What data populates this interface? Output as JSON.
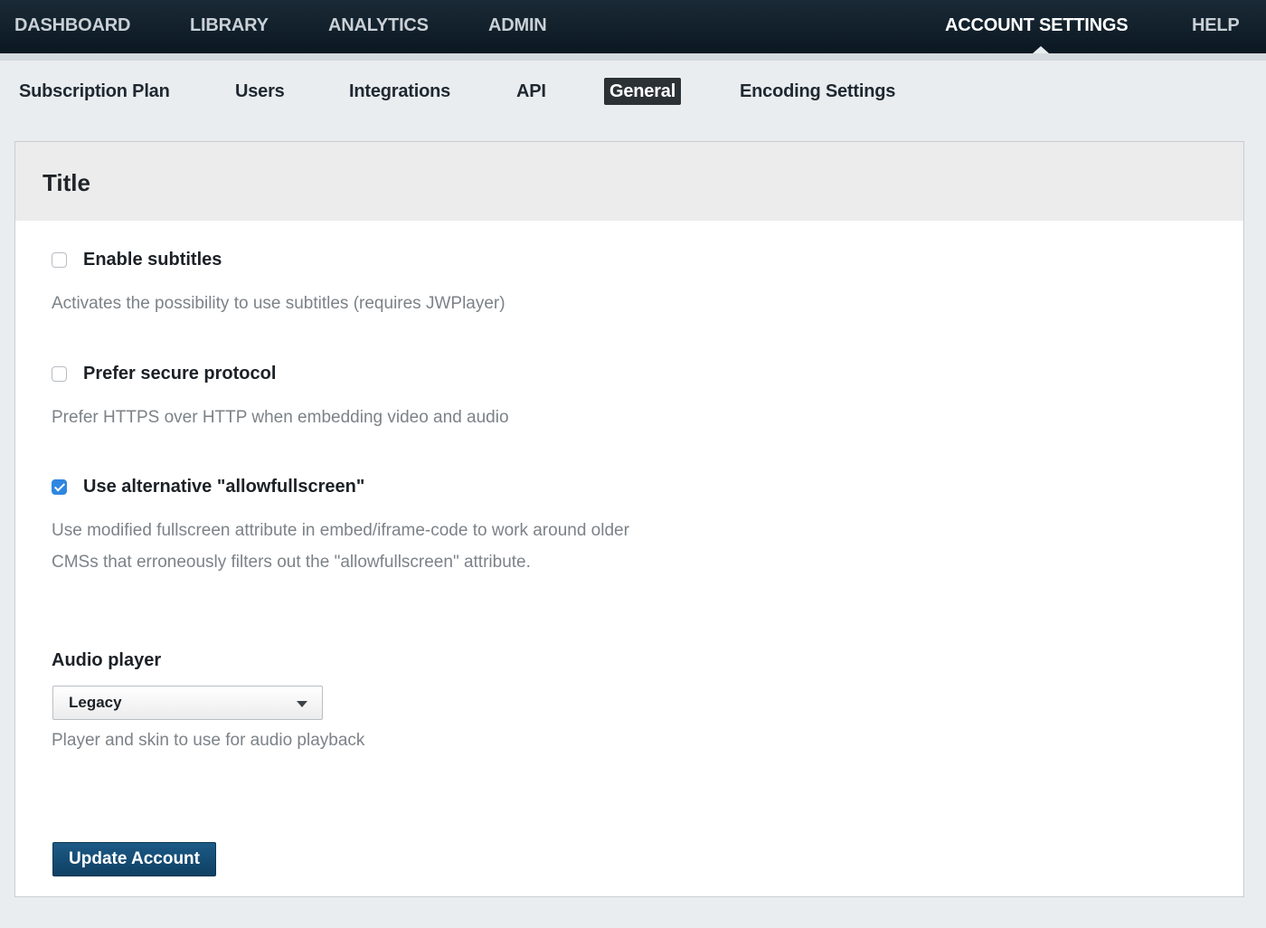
{
  "top_nav": {
    "items": [
      {
        "label": "DASHBOARD",
        "active": false
      },
      {
        "label": "LIBRARY",
        "active": false
      },
      {
        "label": "ANALYTICS",
        "active": false
      },
      {
        "label": "ADMIN",
        "active": false
      },
      {
        "label": "ACCOUNT SETTINGS",
        "active": true
      },
      {
        "label": "HELP",
        "active": false
      }
    ]
  },
  "sub_nav": {
    "items": [
      {
        "label": "Subscription Plan",
        "active": false
      },
      {
        "label": "Users",
        "active": false
      },
      {
        "label": "Integrations",
        "active": false
      },
      {
        "label": "API",
        "active": false
      },
      {
        "label": "General",
        "active": true
      },
      {
        "label": "Encoding Settings",
        "active": false
      }
    ]
  },
  "panel": {
    "title": "Title",
    "options": [
      {
        "label": "Enable subtitles",
        "checked": false,
        "description": "Activates the possibility to use subtitles (requires JWPlayer)"
      },
      {
        "label": "Prefer secure protocol",
        "checked": false,
        "description": "Prefer HTTPS over HTTP when embedding video and audio"
      },
      {
        "label": "Use alternative \"allowfullscreen\"",
        "checked": true,
        "description": "Use modified fullscreen attribute in embed/iframe-code to work around older CMSs that erroneously filters out the \"allowfullscreen\" attribute."
      }
    ],
    "audio_player": {
      "label": "Audio player",
      "selected": "Legacy",
      "help": "Player and skin to use for audio playback"
    },
    "submit_label": "Update Account"
  },
  "colors": {
    "nav_bg": "#0b1822",
    "checkbox_checked": "#2f87e0",
    "button_bg": "#0f4063"
  }
}
